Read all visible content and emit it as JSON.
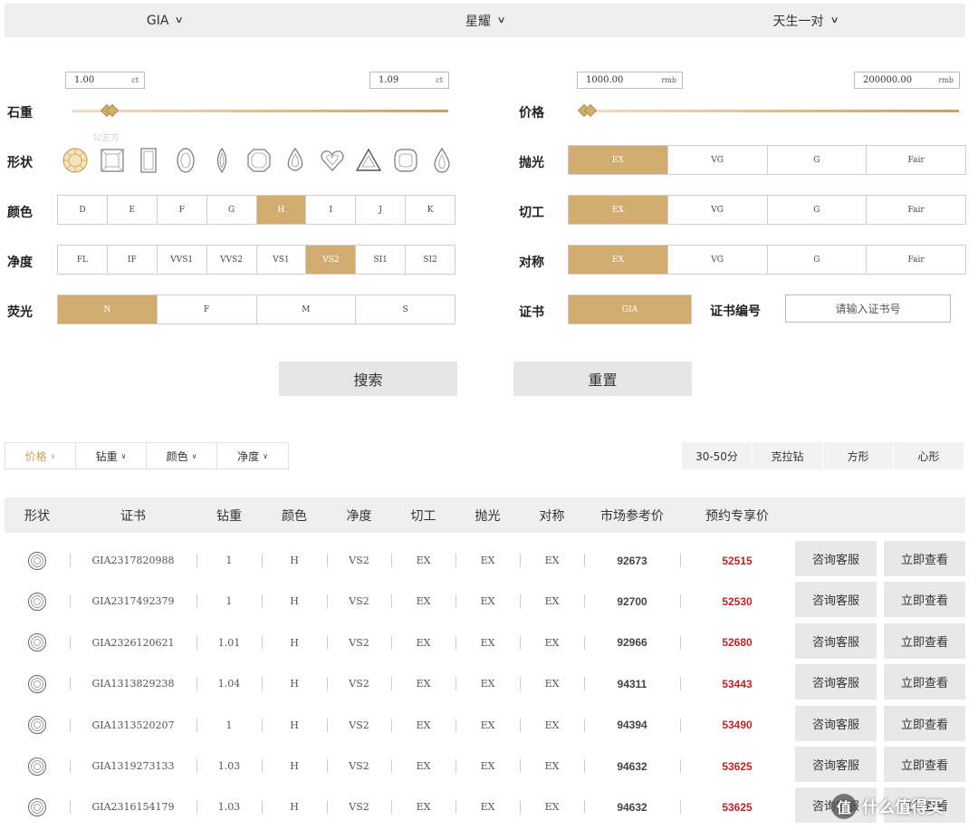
{
  "tabs": [
    {
      "label": "GIA",
      "active": true
    },
    {
      "label": "星耀",
      "active": false
    },
    {
      "label": "天生一对",
      "active": false
    }
  ],
  "carat": {
    "label": "石重",
    "min": "1.00",
    "max": "1.09",
    "unit": "ct"
  },
  "price": {
    "label": "价格",
    "min": "1000.00",
    "max": "200000.00",
    "unit": "rmb"
  },
  "shape_row": {
    "label": "形状",
    "tooltip": "公主方",
    "icons": [
      "round-icon",
      "princess-icon",
      "emerald-icon",
      "oval-icon",
      "marquise-icon",
      "asscher-icon",
      "pear-icon",
      "heart-icon",
      "trillion-icon",
      "cushion-icon",
      "teardrop-icon"
    ]
  },
  "color_row": {
    "label": "颜色",
    "options": [
      "D",
      "E",
      "F",
      "G",
      "H",
      "I",
      "J",
      "K"
    ],
    "selected": "H"
  },
  "clarity_row": {
    "label": "净度",
    "options": [
      "FL",
      "IF",
      "VVS1",
      "VVS2",
      "VS1",
      "VS2",
      "SI1",
      "SI2"
    ],
    "selected": "VS2"
  },
  "fluor_row": {
    "label": "荧光",
    "options": [
      "N",
      "F",
      "M",
      "S"
    ],
    "selected": "N"
  },
  "polish_row": {
    "label": "抛光",
    "options": [
      "EX",
      "VG",
      "G",
      "Fair"
    ],
    "selected": "EX"
  },
  "cut_row": {
    "label": "切工",
    "options": [
      "EX",
      "VG",
      "G",
      "Fair"
    ],
    "selected": "EX"
  },
  "symmetry_row": {
    "label": "对称",
    "options": [
      "EX",
      "VG",
      "G",
      "Fair"
    ],
    "selected": "EX"
  },
  "cert_row": {
    "label": "证书",
    "option": "GIA",
    "no_label": "证书编号",
    "no_placeholder": "请输入证书号"
  },
  "buttons": {
    "search": "搜索",
    "reset": "重置"
  },
  "sort_tabs": [
    {
      "label": "价格",
      "active": true
    },
    {
      "label": "钻重",
      "active": false
    },
    {
      "label": "颜色",
      "active": false
    },
    {
      "label": "净度",
      "active": false
    }
  ],
  "quick_filters": [
    "30-50分",
    "克拉钻",
    "方形",
    "心形"
  ],
  "table": {
    "headers": [
      "形状",
      "证书",
      "钻重",
      "颜色",
      "净度",
      "切工",
      "抛光",
      "对称",
      "市场参考价",
      "预约专享价"
    ],
    "action_labels": {
      "consult": "咨询客服",
      "view": "立即查看"
    },
    "rows": [
      {
        "cert": "GIA2317820988",
        "carat": "1",
        "color": "H",
        "clarity": "VS2",
        "cut": "EX",
        "polish": "EX",
        "sym": "EX",
        "market": "92673",
        "special": "52515"
      },
      {
        "cert": "GIA2317492379",
        "carat": "1",
        "color": "H",
        "clarity": "VS2",
        "cut": "EX",
        "polish": "EX",
        "sym": "EX",
        "market": "92700",
        "special": "52530"
      },
      {
        "cert": "GIA2326120621",
        "carat": "1.01",
        "color": "H",
        "clarity": "VS2",
        "cut": "EX",
        "polish": "EX",
        "sym": "EX",
        "market": "92966",
        "special": "52680"
      },
      {
        "cert": "GIA1313829238",
        "carat": "1.04",
        "color": "H",
        "clarity": "VS2",
        "cut": "EX",
        "polish": "EX",
        "sym": "EX",
        "market": "94311",
        "special": "53443"
      },
      {
        "cert": "GIA1313520207",
        "carat": "1",
        "color": "H",
        "clarity": "VS2",
        "cut": "EX",
        "polish": "EX",
        "sym": "EX",
        "market": "94394",
        "special": "53490"
      },
      {
        "cert": "GIA1319273133",
        "carat": "1.03",
        "color": "H",
        "clarity": "VS2",
        "cut": "EX",
        "polish": "EX",
        "sym": "EX",
        "market": "94632",
        "special": "53625"
      },
      {
        "cert": "GIA2316154179",
        "carat": "1.03",
        "color": "H",
        "clarity": "VS2",
        "cut": "EX",
        "polish": "EX",
        "sym": "EX",
        "market": "94632",
        "special": "53625"
      }
    ]
  },
  "watermark": {
    "badge": "值",
    "text": "什么值得买"
  },
  "colors": {
    "accent": "#d2ad72",
    "price_red": "#b02a2a",
    "gray_bg": "#efefef"
  }
}
